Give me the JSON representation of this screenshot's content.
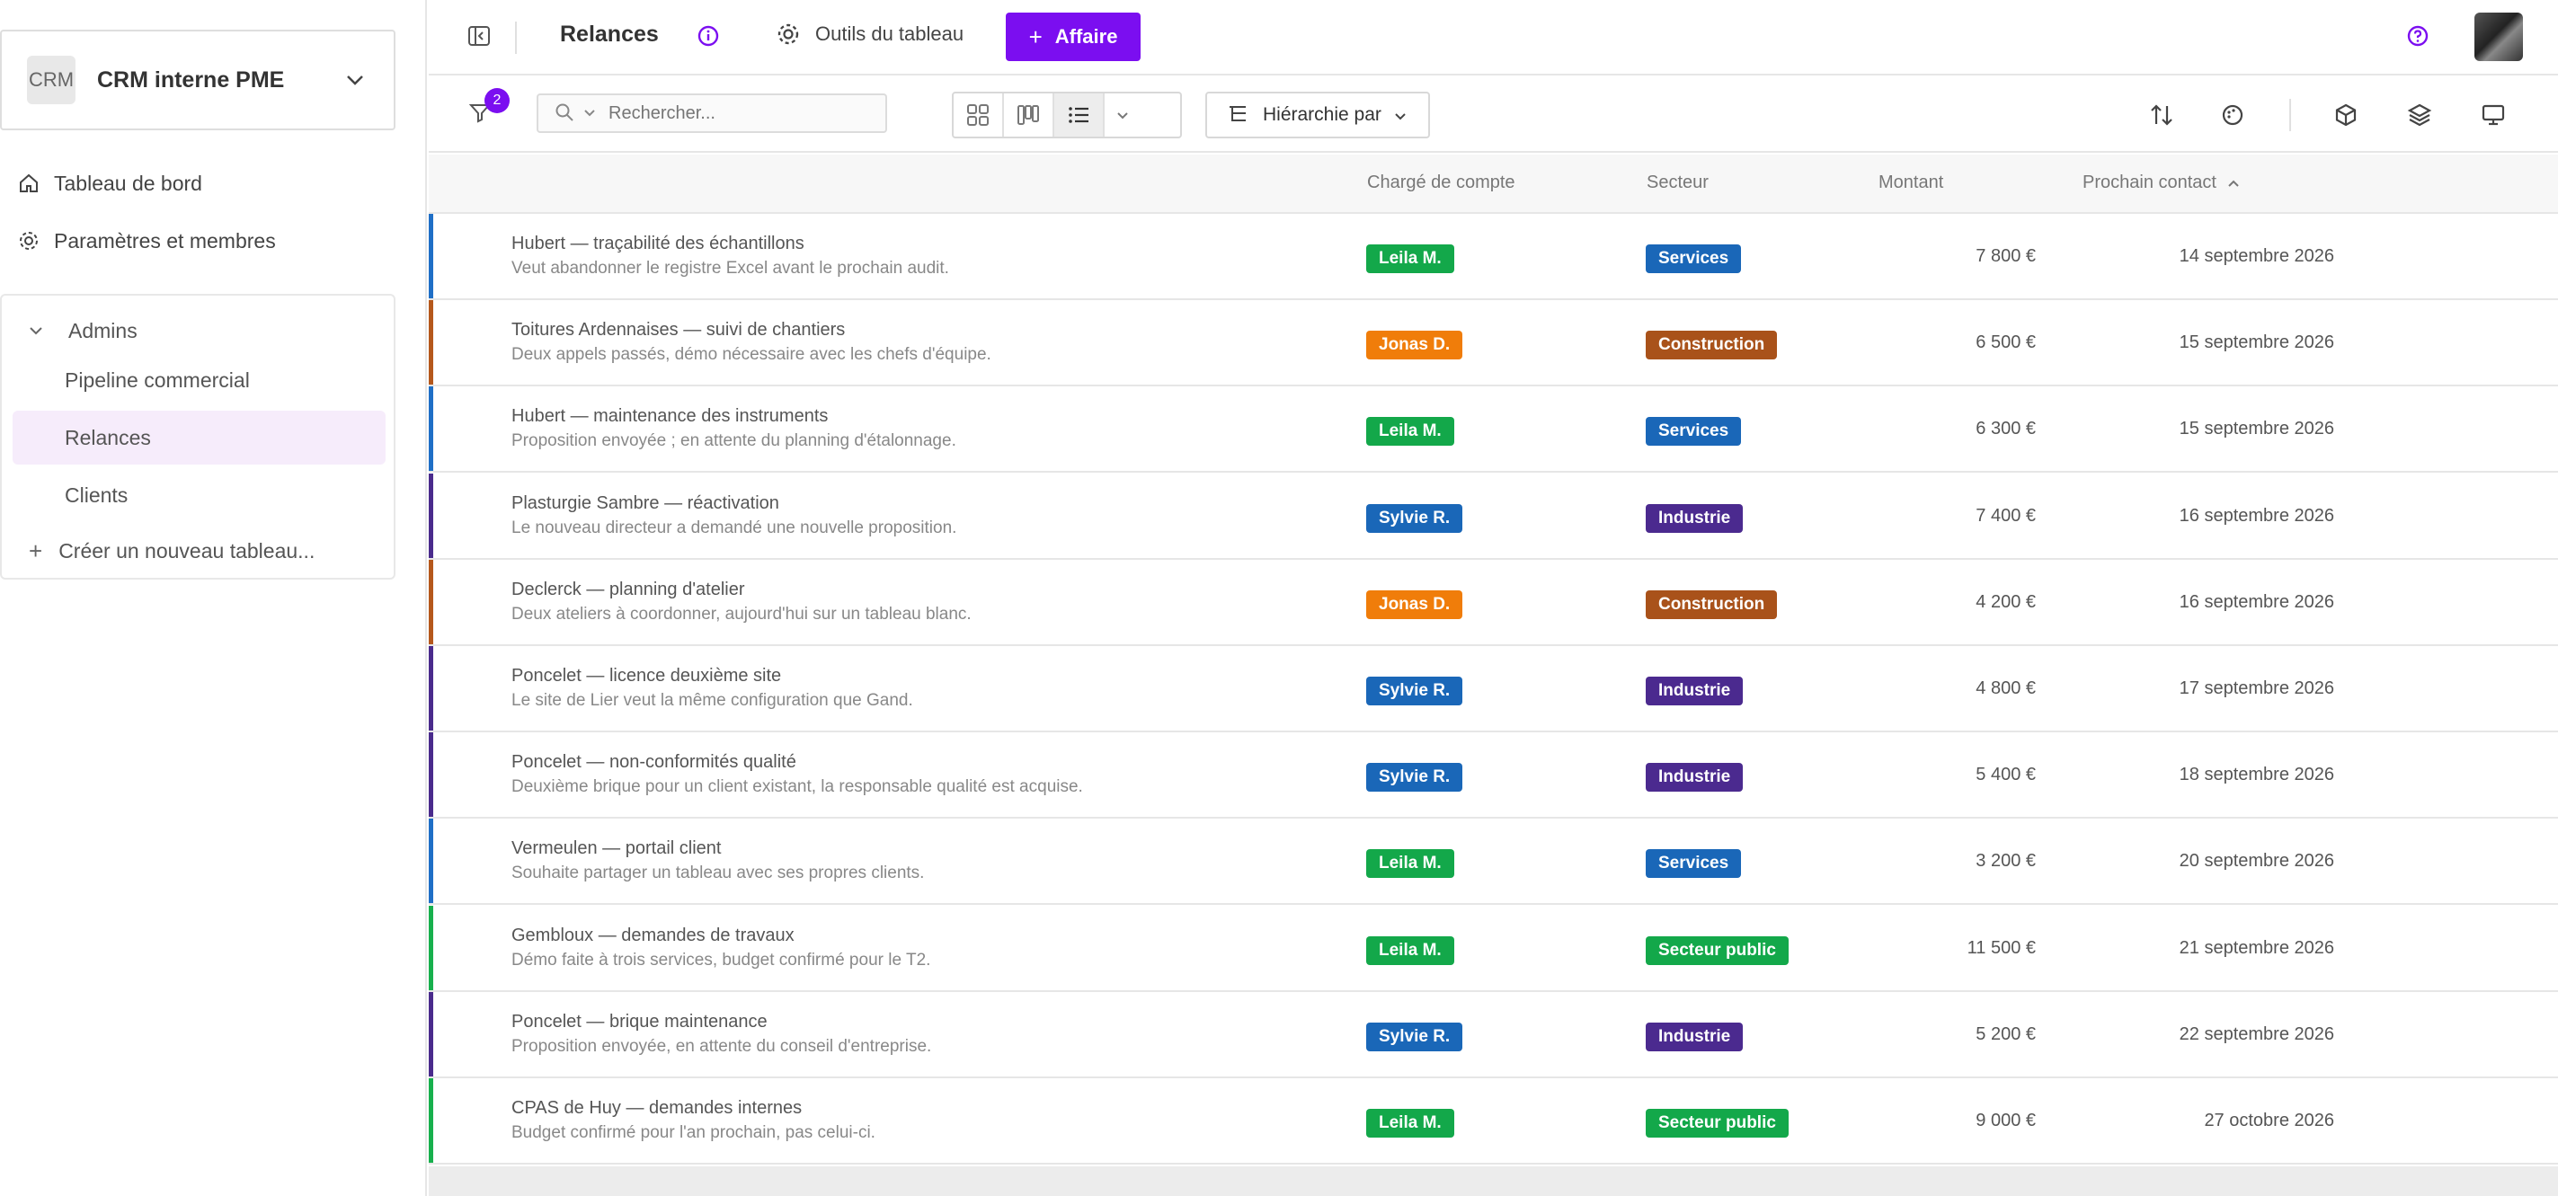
{
  "sidebar": {
    "workspace_logo": "CRM",
    "workspace_name": "CRM interne PME",
    "nav": [
      {
        "label": "Tableau de bord",
        "icon": "home-icon"
      },
      {
        "label": "Paramètres et membres",
        "icon": "gear-icon"
      }
    ],
    "group": {
      "label": "Admins",
      "boards": [
        {
          "label": "Pipeline commercial",
          "active": false
        },
        {
          "label": "Relances",
          "active": true
        },
        {
          "label": "Clients",
          "active": false
        }
      ],
      "create_label": "Créer un nouveau tableau..."
    }
  },
  "topbar": {
    "title": "Relances",
    "tools_label": "Outils du tableau",
    "add_button_label": "Affaire"
  },
  "toolbar": {
    "filter_count": "2",
    "search_placeholder": "Rechercher...",
    "hierarchy_label": "Hiérarchie par"
  },
  "table": {
    "columns": {
      "account_manager": "Chargé de compte",
      "sector": "Secteur",
      "amount": "Montant",
      "next_contact": "Prochain contact"
    },
    "rows": [
      {
        "title": "Hubert — traçabilité des échantillons",
        "subtitle": "Veut abandonner le registre Excel avant le prochain audit.",
        "manager": "Leila M.",
        "sector": "Services",
        "amount": "7 800 €",
        "date": "14 septembre 2026",
        "bar_color": "#1f6fc6"
      },
      {
        "title": "Toitures Ardennaises — suivi de chantiers",
        "subtitle": "Deux appels passés, démo nécessaire avec les chefs d'équipe.",
        "manager": "Jonas D.",
        "sector": "Construction",
        "amount": "6 500 €",
        "date": "15 septembre 2026",
        "bar_color": "#b5581c"
      },
      {
        "title": "Hubert — maintenance des instruments",
        "subtitle": "Proposition envoyée ; en attente du planning d'étalonnage.",
        "manager": "Leila M.",
        "sector": "Services",
        "amount": "6 300 €",
        "date": "15 septembre 2026",
        "bar_color": "#1f6fc6"
      },
      {
        "title": "Plasturgie Sambre — réactivation",
        "subtitle": "Le nouveau directeur a demandé une nouvelle proposition.",
        "manager": "Sylvie R.",
        "sector": "Industrie",
        "amount": "7 400 €",
        "date": "16 septembre 2026",
        "bar_color": "#4a2b8c"
      },
      {
        "title": "Declerck — planning d'atelier",
        "subtitle": "Deux ateliers à coordonner, aujourd'hui sur un tableau blanc.",
        "manager": "Jonas D.",
        "sector": "Construction",
        "amount": "4 200 €",
        "date": "16 septembre 2026",
        "bar_color": "#b5581c"
      },
      {
        "title": "Poncelet — licence deuxième site",
        "subtitle": "Le site de Lier veut la même configuration que Gand.",
        "manager": "Sylvie R.",
        "sector": "Industrie",
        "amount": "4 800 €",
        "date": "17 septembre 2026",
        "bar_color": "#4a2b8c"
      },
      {
        "title": "Poncelet — non-conformités qualité",
        "subtitle": "Deuxième brique pour un client existant, la responsable qualité est acquise.",
        "manager": "Sylvie R.",
        "sector": "Industrie",
        "amount": "5 400 €",
        "date": "18 septembre 2026",
        "bar_color": "#4a2b8c"
      },
      {
        "title": "Vermeulen — portail client",
        "subtitle": "Souhaite partager un tableau avec ses propres clients.",
        "manager": "Leila M.",
        "sector": "Services",
        "amount": "3 200 €",
        "date": "20 septembre 2026",
        "bar_color": "#1f6fc6"
      },
      {
        "title": "Gembloux — demandes de travaux",
        "subtitle": "Démo faite à trois services, budget confirmé pour le T2.",
        "manager": "Leila M.",
        "sector": "Secteur public",
        "amount": "11 500 €",
        "date": "21 septembre 2026",
        "bar_color": "#17b04d"
      },
      {
        "title": "Poncelet — brique maintenance",
        "subtitle": "Proposition envoyée, en attente du conseil d'entreprise.",
        "manager": "Sylvie R.",
        "sector": "Industrie",
        "amount": "5 200 €",
        "date": "22 septembre 2026",
        "bar_color": "#4a2b8c"
      },
      {
        "title": "CPAS de Huy — demandes internes",
        "subtitle": "Budget confirmé pour l'an prochain, pas celui-ci.",
        "manager": "Leila M.",
        "sector": "Secteur public",
        "amount": "9 000 €",
        "date": "27 octobre 2026",
        "bar_color": "#17b04d"
      }
    ]
  },
  "colors": {
    "accent": "#7b0ef0",
    "managers": {
      "Leila M.": "#13a84a",
      "Jonas D.": "#f07d0a",
      "Sylvie R.": "#1a67b8"
    },
    "sectors": {
      "Services": "#1a67b8",
      "Construction": "#a9521a",
      "Industrie": "#4b2a8f",
      "Secteur public": "#13a84a"
    }
  }
}
